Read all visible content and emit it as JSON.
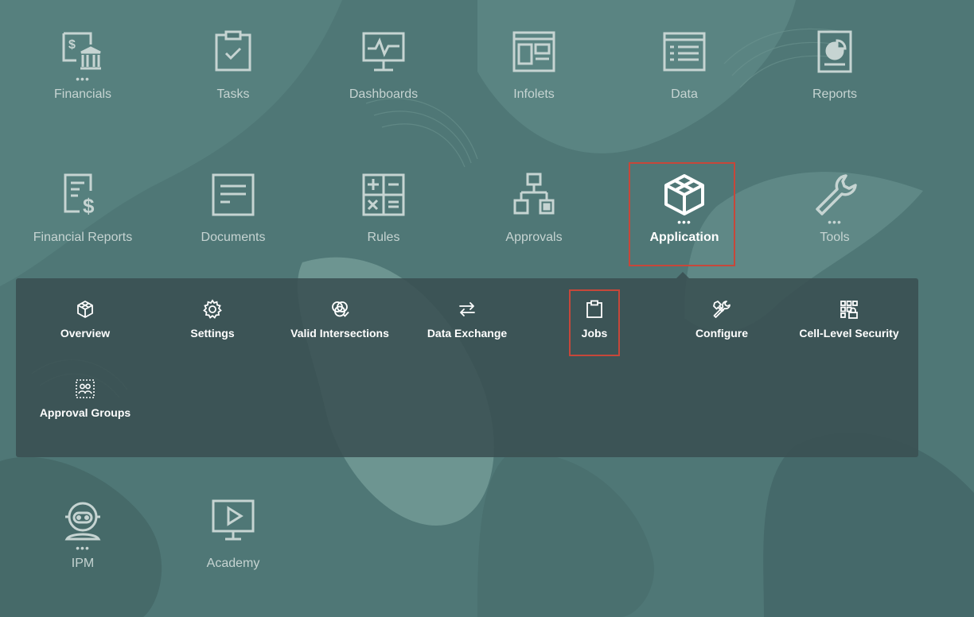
{
  "nav_tiles": [
    {
      "label": "Financials",
      "icon": "financials-icon",
      "more": true
    },
    {
      "label": "Tasks",
      "icon": "tasks-icon",
      "more": false
    },
    {
      "label": "Dashboards",
      "icon": "dashboards-icon",
      "more": false
    },
    {
      "label": "Infolets",
      "icon": "infolets-icon",
      "more": false
    },
    {
      "label": "Data",
      "icon": "data-icon",
      "more": false
    },
    {
      "label": "Reports",
      "icon": "reports-icon",
      "more": false
    },
    {
      "label": "Financial Reports",
      "icon": "financial-reports-icon",
      "more": false
    },
    {
      "label": "Documents",
      "icon": "documents-icon",
      "more": false
    },
    {
      "label": "Rules",
      "icon": "rules-icon",
      "more": false
    },
    {
      "label": "Approvals",
      "icon": "approvals-icon",
      "more": false
    },
    {
      "label": "Application",
      "icon": "application-icon",
      "more": true,
      "active": true
    },
    {
      "label": "Tools",
      "icon": "tools-icon",
      "more": true
    },
    {
      "label": "IPM",
      "icon": "ipm-icon",
      "more": true
    },
    {
      "label": "Academy",
      "icon": "academy-icon",
      "more": false
    }
  ],
  "more_indicator": "•••",
  "submenu": {
    "parent": "Application",
    "items": [
      {
        "label": "Overview",
        "icon": "overview-icon"
      },
      {
        "label": "Settings",
        "icon": "settings-icon"
      },
      {
        "label": "Valid Intersections",
        "icon": "valid-intersections-icon"
      },
      {
        "label": "Data Exchange",
        "icon": "data-exchange-icon"
      },
      {
        "label": "Jobs",
        "icon": "jobs-icon",
        "highlighted": true
      },
      {
        "label": "Configure",
        "icon": "configure-icon"
      },
      {
        "label": "Cell-Level Security",
        "icon": "cell-level-security-icon"
      },
      {
        "label": "Approval Groups",
        "icon": "approval-groups-icon"
      }
    ]
  },
  "colors": {
    "background": "#4f7776",
    "panel": "#3a5052",
    "highlight_border": "#c7473a",
    "icon_muted": "#c6d4d2",
    "icon_active": "#ffffff"
  }
}
